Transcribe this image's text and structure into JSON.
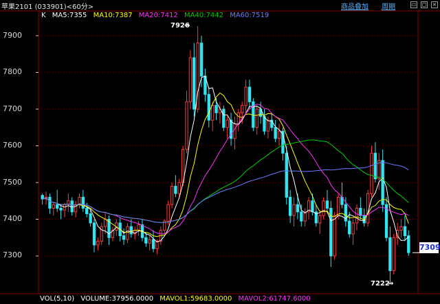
{
  "header": {
    "title": "苹果2101 (033901)<60分>",
    "link_products": "商品叠加",
    "link_cycle": "周期"
  },
  "ma_legend": {
    "label": "K",
    "ma5": "MA5:7355",
    "ma10": "MA10:7387",
    "ma20": "MA20:7412",
    "ma40": "MA40:7442",
    "ma60": "MA60:7519"
  },
  "axis": {
    "ticks": [
      "7900",
      "7800",
      "7700",
      "7600",
      "7500",
      "7400",
      "7300"
    ]
  },
  "annotations": {
    "high": "7926",
    "low": "7222"
  },
  "current_price": "7309",
  "volume_bar": {
    "vol": "VOL(5,10)",
    "volume": "VOLUME:37956.0000",
    "mavol1": "MAVOL1:59683.0000",
    "mavol2": "MAVOL2:61747.6000"
  },
  "colors": {
    "up": "#ff3b3b",
    "down": "#31e4f2",
    "ma5": "#ffffff",
    "ma10": "#ffff00",
    "ma20": "#ff30ff",
    "ma40": "#00d000",
    "ma60": "#6b7cff",
    "link": "#5ab4ff"
  },
  "chart_data": {
    "type": "candlestick",
    "ylim": [
      7200,
      7950
    ],
    "candles": [
      [
        7465,
        7470,
        7440,
        7455
      ],
      [
        7455,
        7475,
        7440,
        7460
      ],
      [
        7460,
        7470,
        7415,
        7430
      ],
      [
        7430,
        7445,
        7410,
        7440
      ],
      [
        7440,
        7480,
        7420,
        7430
      ],
      [
        7430,
        7440,
        7400,
        7425
      ],
      [
        7425,
        7445,
        7405,
        7440
      ],
      [
        7440,
        7470,
        7420,
        7450
      ],
      [
        7450,
        7460,
        7410,
        7420
      ],
      [
        7420,
        7450,
        7405,
        7440
      ],
      [
        7440,
        7470,
        7430,
        7460
      ],
      [
        7460,
        7480,
        7420,
        7430
      ],
      [
        7430,
        7445,
        7405,
        7415
      ],
      [
        7415,
        7430,
        7380,
        7390
      ],
      [
        7390,
        7400,
        7310,
        7330
      ],
      [
        7330,
        7350,
        7315,
        7340
      ],
      [
        7340,
        7390,
        7330,
        7380
      ],
      [
        7380,
        7420,
        7360,
        7400
      ],
      [
        7400,
        7410,
        7330,
        7350
      ],
      [
        7350,
        7380,
        7340,
        7370
      ],
      [
        7370,
        7400,
        7355,
        7390
      ],
      [
        7390,
        7405,
        7340,
        7355
      ],
      [
        7355,
        7375,
        7330,
        7345
      ],
      [
        7345,
        7390,
        7335,
        7380
      ],
      [
        7380,
        7400,
        7350,
        7360
      ],
      [
        7360,
        7380,
        7345,
        7370
      ],
      [
        7370,
        7395,
        7355,
        7385
      ],
      [
        7385,
        7400,
        7340,
        7350
      ],
      [
        7350,
        7365,
        7325,
        7335
      ],
      [
        7335,
        7355,
        7315,
        7345
      ],
      [
        7345,
        7370,
        7310,
        7320
      ],
      [
        7320,
        7345,
        7305,
        7340
      ],
      [
        7340,
        7380,
        7330,
        7370
      ],
      [
        7370,
        7400,
        7360,
        7395
      ],
      [
        7395,
        7450,
        7385,
        7440
      ],
      [
        7440,
        7500,
        7430,
        7490
      ],
      [
        7490,
        7520,
        7460,
        7470
      ],
      [
        7470,
        7510,
        7455,
        7500
      ],
      [
        7500,
        7600,
        7490,
        7590
      ],
      [
        7590,
        7750,
        7580,
        7720
      ],
      [
        7720,
        7860,
        7700,
        7840
      ],
      [
        7840,
        7880,
        7680,
        7700
      ],
      [
        7700,
        7926,
        7690,
        7880
      ],
      [
        7880,
        7900,
        7760,
        7790
      ],
      [
        7790,
        7810,
        7720,
        7740
      ],
      [
        7740,
        7760,
        7650,
        7670
      ],
      [
        7670,
        7720,
        7640,
        7710
      ],
      [
        7710,
        7730,
        7670,
        7690
      ],
      [
        7690,
        7720,
        7660,
        7700
      ],
      [
        7700,
        7710,
        7640,
        7650
      ],
      [
        7650,
        7680,
        7620,
        7670
      ],
      [
        7670,
        7690,
        7600,
        7620
      ],
      [
        7620,
        7680,
        7590,
        7660
      ],
      [
        7660,
        7700,
        7640,
        7690
      ],
      [
        7690,
        7720,
        7660,
        7710
      ],
      [
        7710,
        7780,
        7690,
        7760
      ],
      [
        7760,
        7780,
        7700,
        7720
      ],
      [
        7720,
        7730,
        7640,
        7650
      ],
      [
        7650,
        7710,
        7630,
        7700
      ],
      [
        7700,
        7720,
        7660,
        7680
      ],
      [
        7680,
        7700,
        7630,
        7640
      ],
      [
        7640,
        7680,
        7620,
        7670
      ],
      [
        7670,
        7690,
        7640,
        7650
      ],
      [
        7650,
        7670,
        7610,
        7620
      ],
      [
        7620,
        7660,
        7600,
        7640
      ],
      [
        7640,
        7650,
        7560,
        7580
      ],
      [
        7580,
        7600,
        7440,
        7460
      ],
      [
        7460,
        7480,
        7390,
        7410
      ],
      [
        7410,
        7460,
        7380,
        7440
      ],
      [
        7440,
        7470,
        7400,
        7420
      ],
      [
        7420,
        7440,
        7380,
        7395
      ],
      [
        7395,
        7430,
        7380,
        7420
      ],
      [
        7420,
        7460,
        7400,
        7450
      ],
      [
        7450,
        7470,
        7410,
        7420
      ],
      [
        7420,
        7440,
        7380,
        7390
      ],
      [
        7390,
        7420,
        7360,
        7410
      ],
      [
        7410,
        7460,
        7400,
        7450
      ],
      [
        7450,
        7480,
        7420,
        7430
      ],
      [
        7430,
        7450,
        7270,
        7300
      ],
      [
        7300,
        7420,
        7290,
        7410
      ],
      [
        7410,
        7470,
        7400,
        7460
      ],
      [
        7460,
        7500,
        7430,
        7440
      ],
      [
        7440,
        7460,
        7380,
        7395
      ],
      [
        7395,
        7420,
        7350,
        7360
      ],
      [
        7360,
        7400,
        7330,
        7390
      ],
      [
        7390,
        7440,
        7370,
        7430
      ],
      [
        7430,
        7460,
        7400,
        7410
      ],
      [
        7410,
        7430,
        7380,
        7390
      ],
      [
        7390,
        7480,
        7380,
        7470
      ],
      [
        7470,
        7600,
        7460,
        7580
      ],
      [
        7580,
        7610,
        7500,
        7510
      ],
      [
        7510,
        7580,
        7480,
        7560
      ],
      [
        7560,
        7590,
        7420,
        7440
      ],
      [
        7440,
        7460,
        7340,
        7350
      ],
      [
        7350,
        7380,
        7222,
        7260
      ],
      [
        7260,
        7360,
        7250,
        7350
      ],
      [
        7350,
        7390,
        7330,
        7370
      ],
      [
        7370,
        7400,
        7350,
        7380
      ],
      [
        7380,
        7410,
        7340,
        7355
      ],
      [
        7355,
        7370,
        7300,
        7309
      ]
    ]
  }
}
